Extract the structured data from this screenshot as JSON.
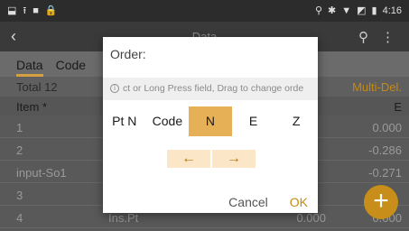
{
  "statusbar": {
    "left_icons": [
      "notification-icon",
      "upload-icon",
      "square-icon",
      "lock-icon"
    ],
    "left_glyphs": [
      "⬓",
      "⭱",
      "■",
      "🔒"
    ],
    "right_glyphs": [
      "⚲",
      "✱",
      "▼",
      "◩",
      "▮"
    ],
    "time": "4:16"
  },
  "appbar": {
    "title": "Data",
    "back_glyph": "‹",
    "search_glyph": "⚲",
    "more_glyph": "⋮"
  },
  "tabs": [
    "Data",
    "Code"
  ],
  "list": {
    "total_label": "Total 12",
    "multi_del_label": "Multi-Del.",
    "header": {
      "item": "Item *",
      "e": "E"
    },
    "rows": [
      {
        "name": "1",
        "col2": "",
        "col3": "",
        "e": "0.000"
      },
      {
        "name": "2",
        "col2": "",
        "col3": "",
        "e": "-0.286"
      },
      {
        "name": "input-So1",
        "col2": "",
        "col3": "",
        "e": "-0.271"
      },
      {
        "name": "3",
        "col2": "",
        "col3": "",
        "e": ""
      },
      {
        "name": "4",
        "col2": "Ins.Pt",
        "col3": "0.000",
        "e": "0.000"
      }
    ]
  },
  "fab": {
    "glyph": "+"
  },
  "dialog": {
    "title": "Order:",
    "info_glyph": "i",
    "hint": "ct or Long Press field, Drag to change orde",
    "fields": [
      "Pt N",
      "Code",
      "N",
      "E",
      "Z"
    ],
    "selected_field": "N",
    "left_arrow": "←",
    "right_arrow": "→",
    "cancel_label": "Cancel",
    "ok_label": "OK"
  },
  "colors": {
    "accent": "#c58a14",
    "selected_field": "#e6b156",
    "arrow_button": "#fbe7c8"
  }
}
